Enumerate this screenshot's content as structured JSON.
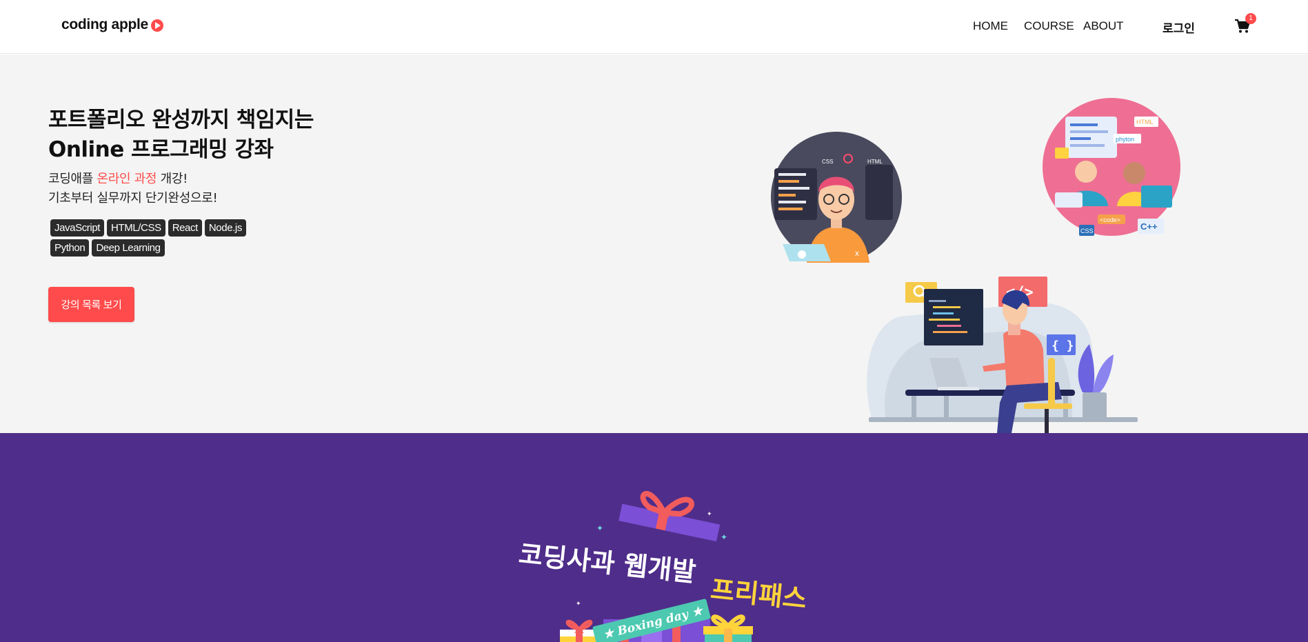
{
  "header": {
    "logo_text": "coding apple",
    "nav": {
      "home": "HOME",
      "course": "COURSE",
      "about": "ABOUT"
    },
    "login": "로그인",
    "cart_count": "1"
  },
  "hero": {
    "title_line1": "포트폴리오 완성까지 책임지는",
    "title_line2": "Online 프로그래밍 강좌",
    "sub_line1_prefix": "코딩애플 ",
    "sub_line1_accent": "온라인 과정",
    "sub_line1_suffix": " 개강!",
    "sub_line2": "기초부터 실무까지 단기완성으로!",
    "tags": [
      "JavaScript",
      "HTML/CSS",
      "React",
      "Node.js",
      "Python",
      "Deep Learning"
    ],
    "cta": "강의 목록 보기"
  },
  "illustration": {
    "left_circle": {
      "css": "CSS",
      "html": "HTML"
    },
    "right_circle": {
      "html": "HTML",
      "python": "phyton",
      "code": "<code>",
      "css": "CSS",
      "cpp": "C++"
    },
    "code_sign": "</>",
    "braces": "{ }"
  },
  "promo": {
    "title_white": "코딩사과 웹개발",
    "title_yellow": "프리패스",
    "ribbon": "★ Boxing day ★"
  },
  "colors": {
    "accent": "#ff4b4b",
    "promo_bg": "#4f2d8a",
    "hero_bg": "#f4f4f4",
    "tag_bg": "#2b2b2b"
  }
}
